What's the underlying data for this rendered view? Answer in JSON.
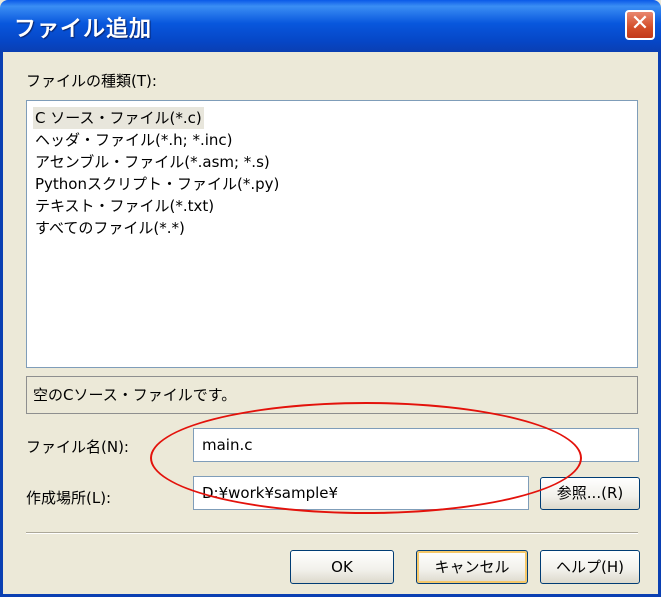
{
  "window": {
    "title": "ファイル追加",
    "close_glyph": "✕"
  },
  "file_type": {
    "label": "ファイルの種類(T):",
    "items": [
      {
        "label": "C ソース・ファイル(*.c)",
        "selected": true
      },
      {
        "label": "ヘッダ・ファイル(*.h; *.inc)",
        "selected": false
      },
      {
        "label": "アセンブル・ファイル(*.asm; *.s)",
        "selected": false
      },
      {
        "label": "Pythonスクリプト・ファイル(*.py)",
        "selected": false
      },
      {
        "label": "テキスト・ファイル(*.txt)",
        "selected": false
      },
      {
        "label": "すべてのファイル(*.*)",
        "selected": false
      }
    ]
  },
  "description": "空のCソース・ファイルです。",
  "file_name": {
    "label": "ファイル名(N):",
    "value": "main.c"
  },
  "location": {
    "label": "作成場所(L):",
    "value": "D:¥work¥sample¥",
    "browse_label": "参照...(R)"
  },
  "buttons": {
    "ok": "OK",
    "cancel": "キャンセル",
    "help": "ヘルプ(H)"
  },
  "colors": {
    "titlebar": "#0a59e8",
    "highlight_ellipse": "#e3120b",
    "dialog_bg": "#ece9d8"
  }
}
